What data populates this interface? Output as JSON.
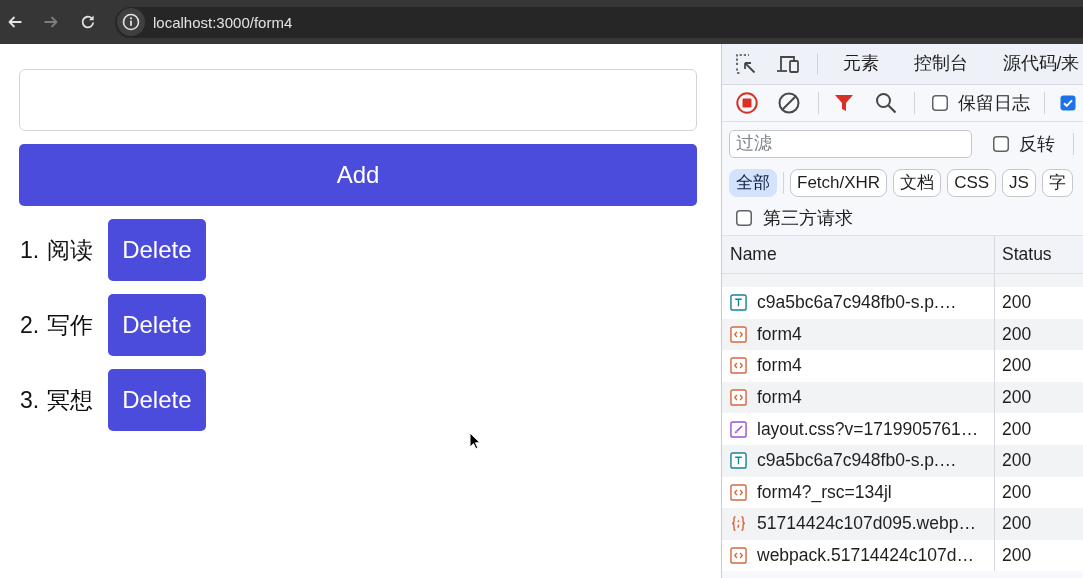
{
  "browser": {
    "nav_buttons": [
      {
        "kind": "back",
        "disabled": false
      },
      {
        "kind": "forward",
        "disabled": true
      },
      {
        "kind": "reload",
        "disabled": false
      }
    ],
    "url": "localhost:3000/form4"
  },
  "page": {
    "add_button": "Add",
    "todos": [
      {
        "number": "1.",
        "text": "阅读",
        "button": "Delete"
      },
      {
        "number": "2.",
        "text": "写作",
        "button": "Delete"
      },
      {
        "number": "3.",
        "text": "冥想",
        "button": "Delete"
      }
    ]
  },
  "devtools": {
    "tabs": [
      {
        "label": "元素",
        "selected": false
      },
      {
        "label": "控制台",
        "selected": false
      },
      {
        "label": "源代码/来",
        "selected": false
      }
    ],
    "toolbar": {
      "recording": true,
      "preserve_log": {
        "label": "保留日志",
        "checked": false
      },
      "trailing_checkbox": {
        "checked": true
      }
    },
    "filter": {
      "placeholder": "过滤",
      "invert": {
        "label": "反转",
        "checked": false
      }
    },
    "type_filters": [
      {
        "label": "全部",
        "selected": true
      },
      {
        "label": "Fetch/XHR",
        "selected": false
      },
      {
        "label": "文档",
        "selected": false
      },
      {
        "label": "CSS",
        "selected": false
      },
      {
        "label": "JS",
        "selected": false
      },
      {
        "label": "字",
        "selected": false
      }
    ],
    "third_party": {
      "label": "第三方请求",
      "checked": false
    },
    "table": {
      "columns": [
        "Name",
        "Status"
      ],
      "rows": [
        {
          "kind": "font",
          "name": "c9a5bc6a7c948fb0-s.p.…",
          "status": "200"
        },
        {
          "kind": "document",
          "name": "form4",
          "status": "200"
        },
        {
          "kind": "document",
          "name": "form4",
          "status": "200"
        },
        {
          "kind": "document",
          "name": "form4",
          "status": "200"
        },
        {
          "kind": "stylesheet",
          "name": "layout.css?v=1719905761…",
          "status": "200"
        },
        {
          "kind": "font",
          "name": "c9a5bc6a7c948fb0-s.p.…",
          "status": "200"
        },
        {
          "kind": "document",
          "name": "form4?_rsc=134jl",
          "status": "200"
        },
        {
          "kind": "script",
          "name": "51714424c107d095.webp…",
          "status": "200"
        },
        {
          "kind": "document",
          "name": "webpack.51714424c107d…",
          "status": "200"
        }
      ]
    }
  }
}
